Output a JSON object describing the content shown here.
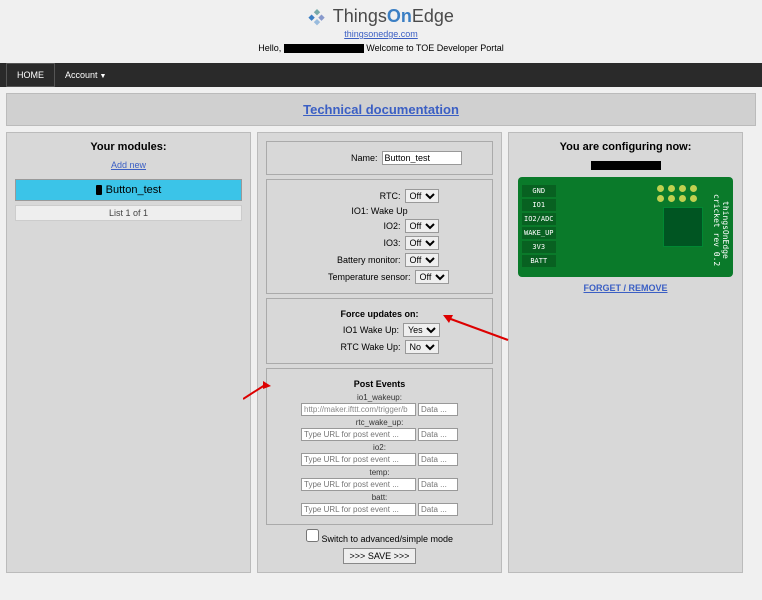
{
  "header": {
    "brand_things": "Things",
    "brand_on": "On",
    "brand_edge": "Edge",
    "site_link": "thingsonedge.com",
    "greeting_hello": "Hello, ",
    "greeting_welcome": "Welcome to TOE Developer Portal"
  },
  "nav": {
    "home": "HOME",
    "account": "Account"
  },
  "docbar": {
    "label": "Technical documentation"
  },
  "left": {
    "title": "Your modules:",
    "add_new": "Add new",
    "module_name": "Button_test",
    "list_info": "List 1 of 1"
  },
  "center": {
    "name_label": "Name:",
    "name_value": "Button_test",
    "rtc_label": "RTC:",
    "rtc_value": "Off",
    "io1wu_label": "IO1: Wake Up",
    "io2_label": "IO2:",
    "io2_value": "Off",
    "io3_label": "IO3:",
    "io3_value": "Off",
    "batt_label": "Battery monitor:",
    "batt_value": "Off",
    "temp_label": "Temperature sensor:",
    "temp_value": "Off",
    "force_title": "Force updates on:",
    "force_io1_label": "IO1 Wake Up:",
    "force_io1_value": "Yes",
    "force_rtc_label": "RTC Wake Up:",
    "force_rtc_value": "No",
    "pe_title": "Post Events",
    "pe": [
      {
        "name": "io1_wakeup:",
        "url": "http://maker.ifttt.com/trigger/b",
        "data": "Data ..."
      },
      {
        "name": "rtc_wake_up:",
        "url": "Type URL for post event ...",
        "data": "Data ..."
      },
      {
        "name": "io2:",
        "url": "Type URL for post event ...",
        "data": "Data ..."
      },
      {
        "name": "temp:",
        "url": "Type URL for post event ...",
        "data": "Data ..."
      },
      {
        "name": "batt:",
        "url": "Type URL for post event ...",
        "data": "Data ..."
      }
    ],
    "switch_label": "Switch to advanced/simple mode",
    "save_label": ">>> SAVE >>>"
  },
  "right": {
    "title": "You are configuring now:",
    "pins": [
      "GND",
      "IO1",
      "IO2/ADC",
      "WAKE_UP",
      "3V3",
      "BATT"
    ],
    "brand_text": "thingsOnEdge cricket rev 0.2",
    "forget": "FORGET / REMOVE"
  }
}
